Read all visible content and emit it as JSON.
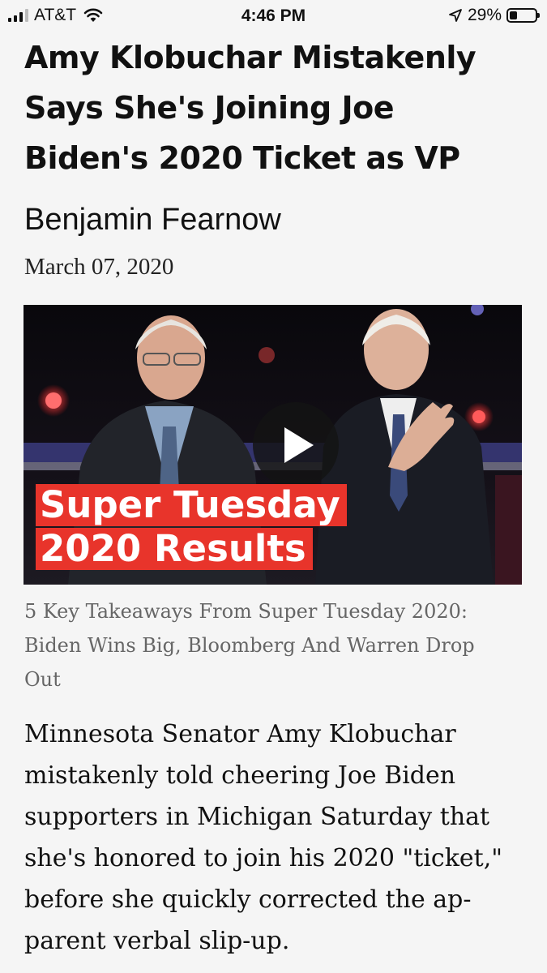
{
  "status_bar": {
    "carrier": "AT&T",
    "time": "4:46 PM",
    "battery_percent": "29%",
    "battery_level": 0.29,
    "icons": [
      "signal-icon",
      "wifi-icon",
      "location-arrow-icon",
      "battery-icon"
    ]
  },
  "article": {
    "headline_lines": [
      "Amy Klobuchar Mistakenly",
      "Says She's Joining Joe",
      "Biden's 2020 Ticket as VP"
    ],
    "author": "Benjamin Fearnow",
    "date": "March 07, 2020",
    "video": {
      "overlay_line1": "Super Tuesday",
      "overlay_line2": "2020 Results",
      "overlay_color": "#e8342b"
    },
    "video_caption_lines": [
      "5 Key Takeaways From Super Tuesday 2020:",
      "Biden Wins Big, Bloomberg And Warren Drop",
      "Out"
    ],
    "body_lines": [
      "Minnesota Senator Amy Klobuchar",
      "mistakenly told cheering Joe Biden",
      "supporters in Michigan Saturday that",
      "she's honored to join his 2020 \"ticket,\"",
      "before she quickly corrected the ap-",
      "parent verbal slip-up."
    ]
  }
}
